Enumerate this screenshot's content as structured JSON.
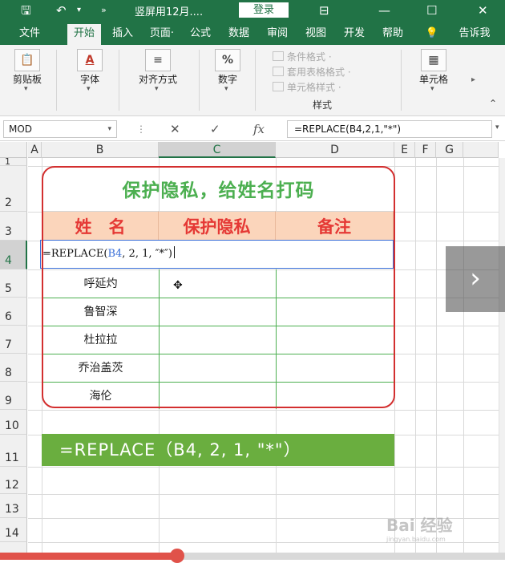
{
  "titlebar": {
    "save_icon": "save-icon",
    "undo_icon": "undo-icon",
    "more_icon": "more-icon",
    "save_glyph": "🖫",
    "undo_glyph": "↶",
    "dropdown_glyph": "▾",
    "more_glyph": "»",
    "doc_title": "竖屏用12月....",
    "login_label": "登录",
    "ribbon_display_glyph": "⊟",
    "minimize_glyph": "—",
    "maximize_glyph": "☐",
    "close_glyph": "✕"
  },
  "tabs": [
    {
      "label": "文件"
    },
    {
      "label": "开始"
    },
    {
      "label": "插入"
    },
    {
      "label": "页面·"
    },
    {
      "label": "公式"
    },
    {
      "label": "数据"
    },
    {
      "label": "审阅"
    },
    {
      "label": "视图"
    },
    {
      "label": "开发"
    },
    {
      "label": "帮助"
    },
    {
      "label": "💡"
    },
    {
      "label": "告诉我"
    }
  ],
  "ribbon": {
    "clipboard": {
      "label": "剪贴板",
      "icon_glyph": "📋"
    },
    "font": {
      "label": "字体",
      "icon_glyph": "A"
    },
    "alignment": {
      "label": "对齐方式",
      "icon_glyph": "≡"
    },
    "number": {
      "label": "数字",
      "icon_glyph": "%"
    },
    "conditional_format": "条件格式 ·",
    "table_format": "套用表格格式 ·",
    "cell_styles": "单元格样式 ·",
    "styles_group": "样式",
    "cells": {
      "label": "单元格",
      "icon_glyph": "▦"
    },
    "dropdown_glyph": "▾",
    "scroll_glyph": "▸",
    "collapse_glyph": "⌃"
  },
  "formula_bar": {
    "name_box": "MOD",
    "dropdown_glyph": "▾",
    "dots_glyph": "⋮",
    "cancel_glyph": "✕",
    "enter_glyph": "✓",
    "fx_label": "fx",
    "formula": "=REPLACE(B4,2,1,\"*\")",
    "expand_glyph": "▾"
  },
  "columns": [
    "A",
    "B",
    "C",
    "D",
    "E",
    "F",
    "G"
  ],
  "rows": [
    "1",
    "2",
    "3",
    "4",
    "5",
    "6",
    "7",
    "8",
    "9",
    "10",
    "11",
    "12",
    "13",
    "14"
  ],
  "table": {
    "title": "保护隐私，给姓名打码",
    "headers": [
      "姓　名",
      "保护隐私",
      "备注"
    ],
    "names": [
      "呼延灼",
      "鲁智深",
      "杜拉拉",
      "乔治盖茨",
      "海伦"
    ]
  },
  "active_cell": {
    "prefix": "=REPLACE(",
    "ref": "B4",
    "suffix": ", 2, 1, ″*″)"
  },
  "cursor_glyph": "✥",
  "banner_text": "=REPLACE（B4, 2, 1, \"*\"）",
  "nav_glyph": "›",
  "watermark": {
    "text": "Bai 经验",
    "sub": "jingyan.baidu.com"
  },
  "progress": {
    "value": 0.35
  },
  "colors": {
    "accent": "#217346",
    "title_green": "#4caf50",
    "header_red": "#e53935",
    "header_fill": "#fbd5bb",
    "banner": "#6aae3f",
    "border_red": "#d32f2f",
    "ref_blue": "#3a6fd8"
  }
}
